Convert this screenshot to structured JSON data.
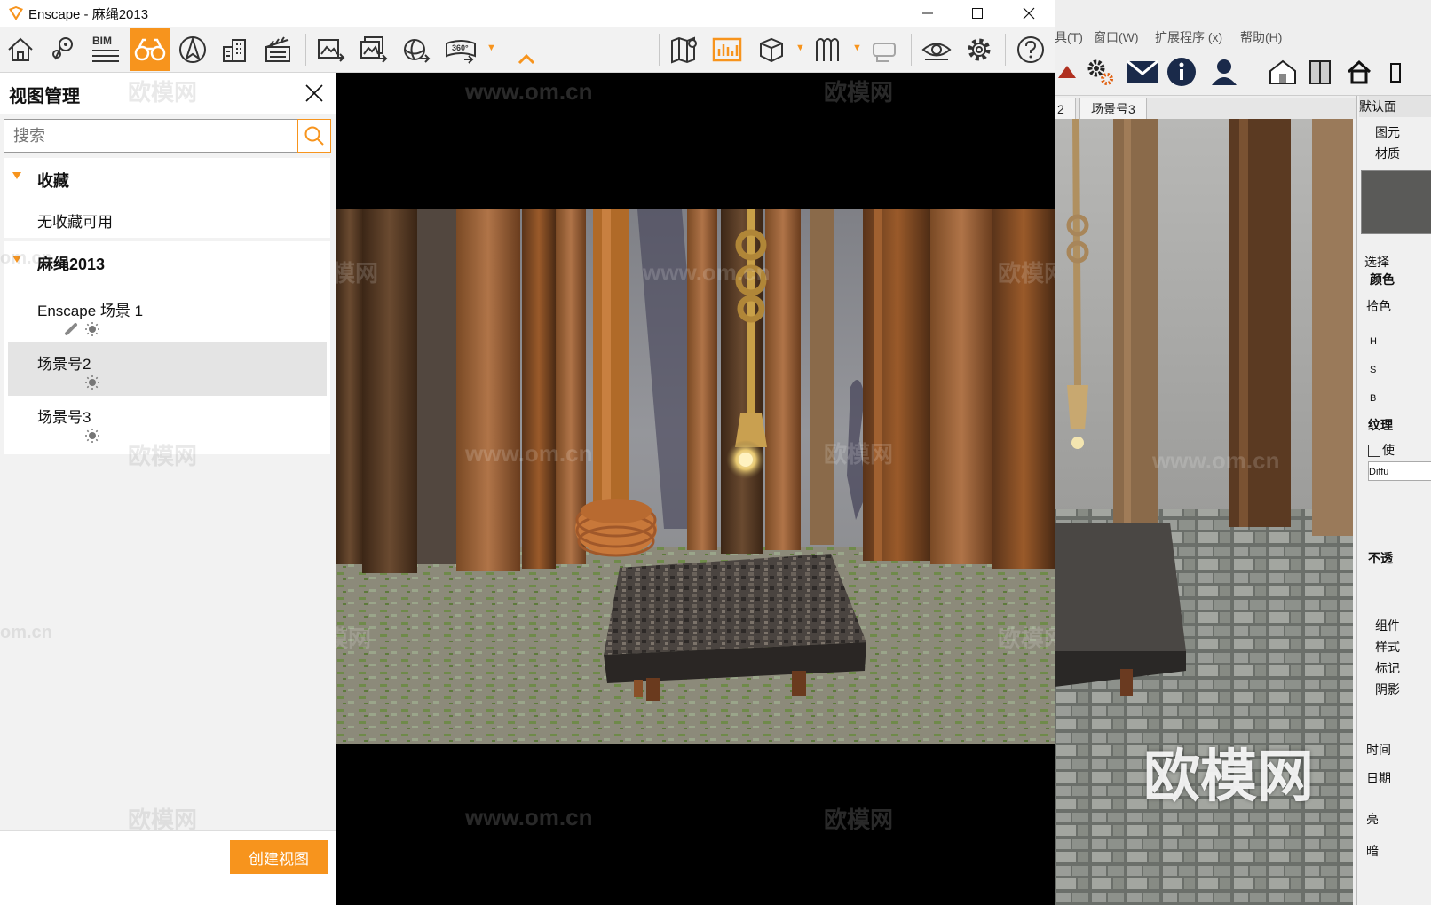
{
  "window": {
    "title": "Enscape - 麻绳2013"
  },
  "toolbar": {
    "bim_label": "BIM",
    "pano_label": "360°"
  },
  "panel": {
    "title": "视图管理",
    "search": {
      "placeholder": "搜索",
      "value": ""
    },
    "favorites": {
      "header": "收藏",
      "empty_text": "无收藏可用"
    },
    "project": {
      "header": "麻绳2013",
      "scenes": [
        {
          "name": "Enscape 场景 1",
          "selected": false,
          "icons": [
            "link-icon",
            "sun-icon"
          ]
        },
        {
          "name": "场景号2",
          "selected": true,
          "icons": [
            "sun-icon"
          ]
        },
        {
          "name": "场景号3",
          "selected": false,
          "icons": [
            "sun-icon"
          ]
        }
      ]
    },
    "create_button": "创建视图"
  },
  "watermarks": {
    "url": "www.om.cn",
    "brand": "欧模网",
    "url_short": "om.cn"
  },
  "background_app": {
    "menu": [
      "具(T)",
      "窗口(W)",
      "扩展程序 (x)",
      "帮助(H)"
    ],
    "tabs": [
      "2",
      "场景号3"
    ],
    "tray": {
      "default": "默认面",
      "sections": [
        "图元",
        "材质"
      ],
      "select_label": "选择",
      "color_label": "颜色",
      "picker_label": "拾色",
      "hsb": [
        "H",
        "S",
        "B"
      ],
      "texture_label": "纹理",
      "use_texture": "使",
      "texture_file": "Diffu",
      "opacity_label": "不透",
      "more_sections": [
        "组件",
        "样式",
        "标记",
        "阴影"
      ],
      "time_label": "时间",
      "date_label": "日期",
      "light_label": "亮",
      "dark_label": "暗"
    }
  },
  "colors": {
    "accent": "#f7941d",
    "panel_bg": "#f2f2f2",
    "selected_row": "#e4e4e4"
  }
}
